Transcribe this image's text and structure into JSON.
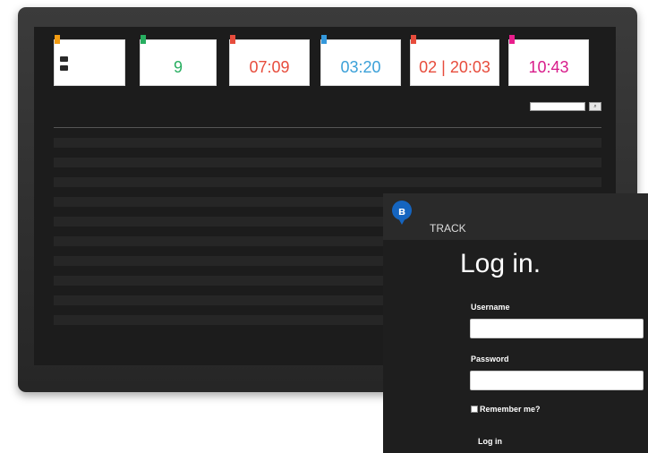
{
  "dashboard": {
    "cards": [
      {
        "tag": "",
        "tag_color": "#f39c12",
        "value": "",
        "value_color": "#333333",
        "rows": [
          "",
          ""
        ]
      },
      {
        "tag": "",
        "tag_color": "#27ae60",
        "value": "9",
        "value_color": "#27ae60",
        "sub": ""
      },
      {
        "tag": "",
        "tag_color": "#e74c3c",
        "value": "07:09",
        "value_color": "#e74c3c",
        "sub": ""
      },
      {
        "tag": "",
        "tag_color": "#3498db",
        "value": "03:20",
        "value_color": "#3aa0d8",
        "sub": ""
      },
      {
        "tag": "",
        "tag_color": "#e74c3c",
        "value": "02 | 20:03",
        "value_color": "#e74c3c",
        "sub": ""
      },
      {
        "tag": "",
        "tag_color": "#e91e8c",
        "value": "10:43",
        "value_color": "#d81b8a",
        "sub": ""
      }
    ],
    "search_placeholder": "",
    "table": {
      "headers": [
        "",
        "",
        "",
        "",
        "",
        "",
        "",
        "",
        ""
      ],
      "row_count": 20
    }
  },
  "login": {
    "brand": "TRACK",
    "brand_sub": "",
    "title": "Log in.",
    "username_label": "Username",
    "username_value": "",
    "password_label": "Password",
    "password_value": "",
    "remember_label": "Remember me?",
    "submit_label": "Log in"
  },
  "colors": {
    "screen_bg": "#1c1c1c",
    "login_bg": "#1e1e1e",
    "accent_blue": "#1565c0"
  },
  "icons": {
    "brand": "bluetooth-pin-icon",
    "search": "search-icon",
    "folder": "folder-icon"
  }
}
